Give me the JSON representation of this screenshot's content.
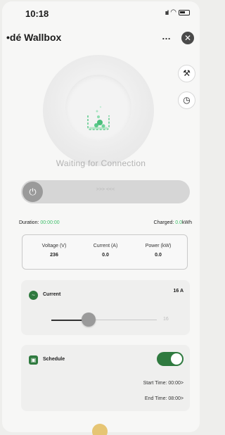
{
  "status_bar": {
    "time": "10:18",
    "signal": "ııl",
    "wifi": "◠"
  },
  "header": {
    "title": "•dé Wallbox",
    "more": "…",
    "close": "✕"
  },
  "gauge": {
    "tools_icon": "⚒",
    "timer_icon": "◷"
  },
  "status_text": "Waiting for Connection",
  "power_slider": {
    "knob_icon": "⏻",
    "hint": ">>> <<<"
  },
  "stats": {
    "duration_label": "Duration:",
    "duration_value": "00:00:00",
    "charged_label": "Charged:",
    "charged_value": "0.0",
    "charged_unit": "kWh"
  },
  "metrics": [
    {
      "label": "Voltage (V)",
      "value": "236"
    },
    {
      "label": "Current (A)",
      "value": "0.0"
    },
    {
      "label": "Power (kW)",
      "value": "0.0"
    }
  ],
  "current": {
    "title": "Current",
    "value_label": "16 A",
    "slider_fraction": 0.35,
    "max_label": "16",
    "icon": "~"
  },
  "schedule": {
    "title": "Schedule",
    "enabled": true,
    "start_label": "Start Time: 00:00>",
    "end_label": "End Time: 08:00>",
    "icon": "▣"
  },
  "colors": {
    "accent_green": "#2f7a3f",
    "value_green": "#3fbf6a"
  }
}
